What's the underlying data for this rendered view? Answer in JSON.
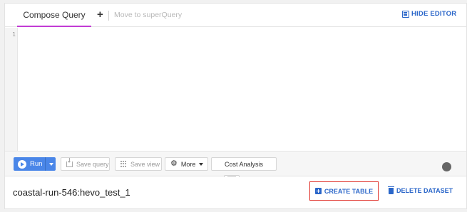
{
  "tabs": {
    "compose_label": "Compose Query",
    "add_symbol": "+",
    "move_label": "Move to superQuery",
    "hide_editor_label": "HIDE EDITOR"
  },
  "editor": {
    "line_number": "1",
    "content": ""
  },
  "toolbar": {
    "run_label": "Run",
    "save_query_label": "Save query",
    "save_view_label": "Save view",
    "more_label": "More",
    "cost_analysis_label": "Cost Analysis"
  },
  "dataset": {
    "name": "coastal-run-546:hevo_test_1",
    "create_table_label": "CREATE TABLE",
    "delete_dataset_label": "DELETE DATASET"
  },
  "colors": {
    "accent": "#2a66c9",
    "run_button": "#4a86e8",
    "active_tab_underline": "#c23bd4",
    "highlight_border": "#e0332c"
  },
  "icons": [
    "hide-editor-icon",
    "play-icon",
    "dropdown-caret-icon",
    "download-icon",
    "grid-icon",
    "gear-icon",
    "plus-box-icon",
    "trash-icon"
  ]
}
